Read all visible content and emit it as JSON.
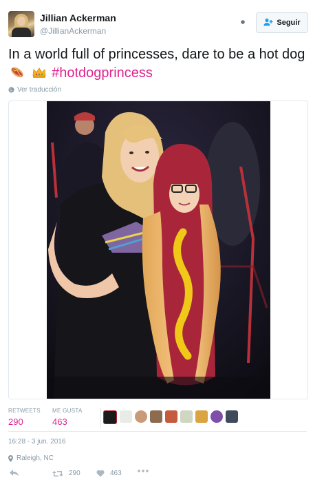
{
  "user": {
    "name": "Jillian Ackerman",
    "handle": "@JillianAckerman"
  },
  "header": {
    "follow_label": "Seguir"
  },
  "tweet": {
    "text_part1": "In a world full of princesses, dare to be a hot dog",
    "hashtag": "#hotdogprincess",
    "translate_label": "Ver traducción"
  },
  "stats": {
    "retweets_label": "RETWEETS",
    "retweets_value": "290",
    "likes_label": "ME GUSTA",
    "likes_value": "463"
  },
  "timestamp": "16:28 - 3 jun. 2016",
  "location": "Raleigh, NC",
  "actions": {
    "retweet_count": "290",
    "like_count": "463"
  },
  "colors": {
    "hashtag": "#e0248e",
    "muted": "#8899a6",
    "text": "#14171a",
    "border": "#e1e8ed"
  },
  "icons": [
    "gear-icon",
    "follow-user-icon",
    "hotdog-emoji",
    "crown-emoji",
    "globe-icon",
    "pin-icon",
    "reply-icon",
    "retweet-icon",
    "heart-icon",
    "more-icon"
  ]
}
